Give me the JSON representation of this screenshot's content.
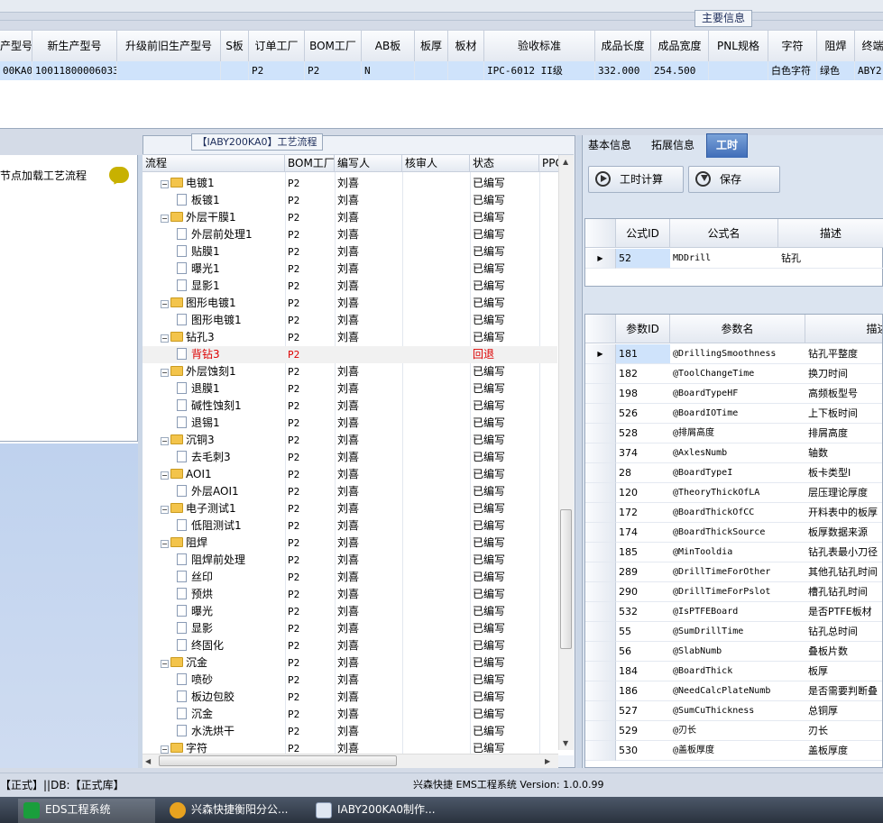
{
  "top": {
    "section_title": "主要信息",
    "order_columns": [
      "产型号",
      "新生产型号",
      "升级前旧生产型号",
      "S板",
      "订单工厂",
      "BOM工厂",
      "AB板",
      "板厚",
      "板材",
      "验收标准",
      "成品长度",
      "成品宽度",
      "PNL规格",
      "字符",
      "阻焊",
      "终端"
    ],
    "order_row": [
      "00KA0",
      "10011800006033",
      "",
      "",
      "P2",
      "P2",
      "N",
      "",
      "",
      "IPC-6012 II级",
      "332.000",
      "254.500",
      "",
      "白色字符",
      "绿色",
      "ABY2"
    ]
  },
  "left": {
    "label": "节点加载工艺流程"
  },
  "flow": {
    "title": "【IABY200KA0】工艺流程",
    "columns": [
      "流程",
      "BOM工厂",
      "编写人",
      "核审人",
      "状态",
      "PPC"
    ],
    "rows": [
      {
        "level": 1,
        "kind": "folder",
        "name": "电镀1",
        "bom": "P2",
        "writer": "刘喜",
        "status": "已编写",
        "red": false
      },
      {
        "level": 2,
        "kind": "doc",
        "name": "板镀1",
        "bom": "P2",
        "writer": "刘喜",
        "status": "已编写",
        "red": false
      },
      {
        "level": 1,
        "kind": "folder",
        "name": "外层干膜1",
        "bom": "P2",
        "writer": "刘喜",
        "status": "已编写",
        "red": false
      },
      {
        "level": 2,
        "kind": "doc",
        "name": "外层前处理1",
        "bom": "P2",
        "writer": "刘喜",
        "status": "已编写",
        "red": false
      },
      {
        "level": 2,
        "kind": "doc",
        "name": "贴膜1",
        "bom": "P2",
        "writer": "刘喜",
        "status": "已编写",
        "red": false
      },
      {
        "level": 2,
        "kind": "doc",
        "name": "曝光1",
        "bom": "P2",
        "writer": "刘喜",
        "status": "已编写",
        "red": false
      },
      {
        "level": 2,
        "kind": "doc",
        "name": "显影1",
        "bom": "P2",
        "writer": "刘喜",
        "status": "已编写",
        "red": false
      },
      {
        "level": 1,
        "kind": "folder",
        "name": "图形电镀1",
        "bom": "P2",
        "writer": "刘喜",
        "status": "已编写",
        "red": false
      },
      {
        "level": 2,
        "kind": "doc",
        "name": "图形电镀1",
        "bom": "P2",
        "writer": "刘喜",
        "status": "已编写",
        "red": false
      },
      {
        "level": 1,
        "kind": "folder",
        "name": "钻孔3",
        "bom": "P2",
        "writer": "刘喜",
        "status": "已编写",
        "red": false
      },
      {
        "level": 2,
        "kind": "doc",
        "name": "背钻3",
        "bom": "P2",
        "writer": "",
        "status": "回退",
        "red": true
      },
      {
        "level": 1,
        "kind": "folder",
        "name": "外层蚀刻1",
        "bom": "P2",
        "writer": "刘喜",
        "status": "已编写",
        "red": false
      },
      {
        "level": 2,
        "kind": "doc",
        "name": "退膜1",
        "bom": "P2",
        "writer": "刘喜",
        "status": "已编写",
        "red": false
      },
      {
        "level": 2,
        "kind": "doc",
        "name": "碱性蚀刻1",
        "bom": "P2",
        "writer": "刘喜",
        "status": "已编写",
        "red": false
      },
      {
        "level": 2,
        "kind": "doc",
        "name": "退锡1",
        "bom": "P2",
        "writer": "刘喜",
        "status": "已编写",
        "red": false
      },
      {
        "level": 1,
        "kind": "folder",
        "name": "沉铜3",
        "bom": "P2",
        "writer": "刘喜",
        "status": "已编写",
        "red": false
      },
      {
        "level": 2,
        "kind": "doc",
        "name": "去毛刺3",
        "bom": "P2",
        "writer": "刘喜",
        "status": "已编写",
        "red": false
      },
      {
        "level": 1,
        "kind": "folder",
        "name": "AOI1",
        "bom": "P2",
        "writer": "刘喜",
        "status": "已编写",
        "red": false
      },
      {
        "level": 2,
        "kind": "doc",
        "name": "外层AOI1",
        "bom": "P2",
        "writer": "刘喜",
        "status": "已编写",
        "red": false
      },
      {
        "level": 1,
        "kind": "folder",
        "name": "电子测试1",
        "bom": "P2",
        "writer": "刘喜",
        "status": "已编写",
        "red": false
      },
      {
        "level": 2,
        "kind": "doc",
        "name": "低阻测试1",
        "bom": "P2",
        "writer": "刘喜",
        "status": "已编写",
        "red": false
      },
      {
        "level": 1,
        "kind": "folder",
        "name": "阻焊",
        "bom": "P2",
        "writer": "刘喜",
        "status": "已编写",
        "red": false
      },
      {
        "level": 2,
        "kind": "doc",
        "name": "阻焊前处理",
        "bom": "P2",
        "writer": "刘喜",
        "status": "已编写",
        "red": false
      },
      {
        "level": 2,
        "kind": "doc",
        "name": "丝印",
        "bom": "P2",
        "writer": "刘喜",
        "status": "已编写",
        "red": false
      },
      {
        "level": 2,
        "kind": "doc",
        "name": "预烘",
        "bom": "P2",
        "writer": "刘喜",
        "status": "已编写",
        "red": false
      },
      {
        "level": 2,
        "kind": "doc",
        "name": "曝光",
        "bom": "P2",
        "writer": "刘喜",
        "status": "已编写",
        "red": false
      },
      {
        "level": 2,
        "kind": "doc",
        "name": "显影",
        "bom": "P2",
        "writer": "刘喜",
        "status": "已编写",
        "red": false
      },
      {
        "level": 2,
        "kind": "doc",
        "name": "终固化",
        "bom": "P2",
        "writer": "刘喜",
        "status": "已编写",
        "red": false
      },
      {
        "level": 1,
        "kind": "folder",
        "name": "沉金",
        "bom": "P2",
        "writer": "刘喜",
        "status": "已编写",
        "red": false
      },
      {
        "level": 2,
        "kind": "doc",
        "name": "喷砂",
        "bom": "P2",
        "writer": "刘喜",
        "status": "已编写",
        "red": false
      },
      {
        "level": 2,
        "kind": "doc",
        "name": "板边包胶",
        "bom": "P2",
        "writer": "刘喜",
        "status": "已编写",
        "red": false
      },
      {
        "level": 2,
        "kind": "doc",
        "name": "沉金",
        "bom": "P2",
        "writer": "刘喜",
        "status": "已编写",
        "red": false
      },
      {
        "level": 2,
        "kind": "doc",
        "name": "水洗烘干",
        "bom": "P2",
        "writer": "刘喜",
        "status": "已编写",
        "red": false
      },
      {
        "level": 1,
        "kind": "folder",
        "name": "字符",
        "bom": "P2",
        "writer": "刘喜",
        "status": "已编写",
        "red": false
      }
    ]
  },
  "right": {
    "tabs": [
      "基本信息",
      "拓展信息",
      "工时"
    ],
    "calc_button": "工时计算",
    "save_button": "保存",
    "formula_columns": [
      "公式ID",
      "公式名",
      "描述"
    ],
    "formula_row": [
      "52",
      "MDDrill",
      "钻孔"
    ],
    "param_columns": [
      "参数ID",
      "参数名",
      "描述"
    ],
    "params": [
      [
        "181",
        "@DrillingSmoothness",
        "钻孔平整度"
      ],
      [
        "182",
        "@ToolChangeTime",
        "换刀时间"
      ],
      [
        "198",
        "@BoardTypeHF",
        "高频板型号"
      ],
      [
        "526",
        "@BoardIOTime",
        "上下板时间"
      ],
      [
        "528",
        "@排屑高度",
        "排屑高度"
      ],
      [
        "374",
        "@AxlesNumb",
        "轴数"
      ],
      [
        "28",
        "@BoardTypeI",
        "板卡类型I"
      ],
      [
        "120",
        "@TheoryThickOfLA",
        "层压理论厚度"
      ],
      [
        "172",
        "@BoardThickOfCC",
        "开料表中的板厚"
      ],
      [
        "174",
        "@BoardThickSource",
        "板厚数据来源"
      ],
      [
        "185",
        "@MinTooldia",
        "钻孔表最小刀径"
      ],
      [
        "289",
        "@DrillTimeForOther",
        "其他孔钻孔时间"
      ],
      [
        "290",
        "@DrillTimeForPslot",
        "槽孔钻孔时间"
      ],
      [
        "532",
        "@IsPTFEBoard",
        "是否PTFE板材"
      ],
      [
        "55",
        "@SumDrillTime",
        "钻孔总时间"
      ],
      [
        "56",
        "@SlabNumb",
        "叠板片数"
      ],
      [
        "184",
        "@BoardThick",
        "板厚"
      ],
      [
        "186",
        "@NeedCalcPlateNumb",
        "是否需要判断叠"
      ],
      [
        "527",
        "@SumCuThickness",
        "总铜厚"
      ],
      [
        "529",
        "@刃长",
        "刃长"
      ],
      [
        "530",
        "@盖板厚度",
        "盖板厚度"
      ]
    ]
  },
  "status": {
    "left": "【正式】||DB:【正式库】",
    "center": "兴森快捷 EMS工程系统 Version: 1.0.0.99"
  },
  "taskbar": {
    "items": [
      "EDS工程系统",
      "兴森快捷衡阳分公...",
      "IABY200KA0制作..."
    ]
  },
  "colors": {
    "accent": "#3f6db8",
    "selection": "#cfe3fb",
    "rollback": "#dd0000"
  }
}
